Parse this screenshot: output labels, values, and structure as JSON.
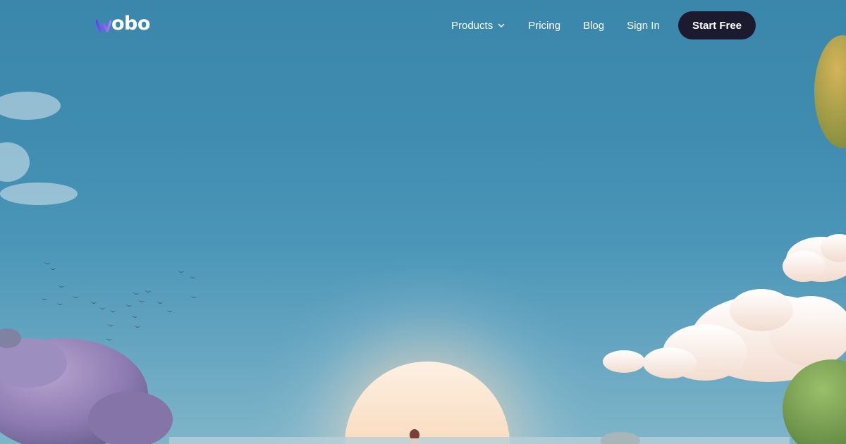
{
  "brand": {
    "name": "wobo",
    "logo_text": "obo",
    "colors": {
      "logo_gradient_start": "#5b3ff5",
      "logo_gradient_end": "#b57af5",
      "cta_background": "#1c1a2e",
      "sky": "#3f8cb0",
      "sun": "#fbe7d4"
    }
  },
  "nav": {
    "items": [
      {
        "label": "Products",
        "icon": "chevron-down-icon"
      },
      {
        "label": "Pricing"
      },
      {
        "label": "Blog"
      },
      {
        "label": "Sign In"
      }
    ],
    "cta_label": "Start Free"
  },
  "hero": {
    "elements": [
      "sky",
      "sun",
      "clouds",
      "birds",
      "trees",
      "child-silhouette"
    ]
  }
}
